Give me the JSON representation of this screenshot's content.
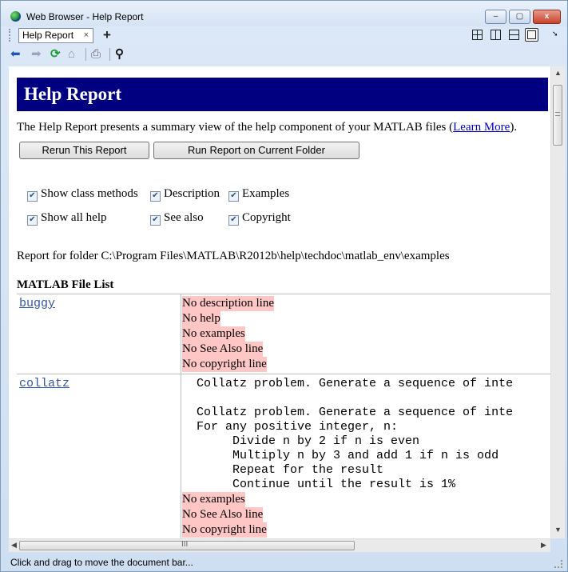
{
  "window": {
    "title": "Web Browser - Help Report"
  },
  "tabs": [
    {
      "label": "Help Report",
      "close": "×"
    }
  ],
  "new_tab": "+",
  "window_controls": {
    "minimize": "–",
    "maximize": "▢",
    "close": "x"
  },
  "report": {
    "header": "Help Report",
    "intro_text": "The Help Report presents a summary view of the help component of your MATLAB files (",
    "learn_more": "Learn More",
    "intro_end": ").",
    "buttons": {
      "rerun": "Rerun This Report",
      "run_current": "Run Report on Current Folder"
    },
    "options": [
      {
        "label": "Show class methods",
        "checked": true
      },
      {
        "label": "Description",
        "checked": true
      },
      {
        "label": "Examples",
        "checked": true
      },
      {
        "label": "Show all help",
        "checked": true
      },
      {
        "label": "See also",
        "checked": true
      },
      {
        "label": "Copyright",
        "checked": true
      }
    ],
    "folder_text": "Report for folder  C:\\Program Files\\MATLAB\\R2012b\\help\\techdoc\\matlab_env\\examples",
    "list_title": "MATLAB File List",
    "files": [
      {
        "name": "buggy",
        "messages": [
          "No description line",
          "No help",
          "No examples",
          "No See Also line",
          "No copyright line"
        ]
      },
      {
        "name": "collatz",
        "desc_line": "  Collatz problem. Generate a sequence of inte",
        "help_lines": [
          "  Collatz problem. Generate a sequence of inte",
          "  For any positive integer, n:",
          "       Divide n by 2 if n is even",
          "       Multiply n by 3 and add 1 if n is odd",
          "       Repeat for the result",
          "       Continue until the result is 1%"
        ],
        "messages": [
          "No examples",
          "No See Also line",
          "No copyright line"
        ]
      }
    ]
  },
  "scrollbar_h_label": "III",
  "status_text": "Click and drag to move the document bar..."
}
